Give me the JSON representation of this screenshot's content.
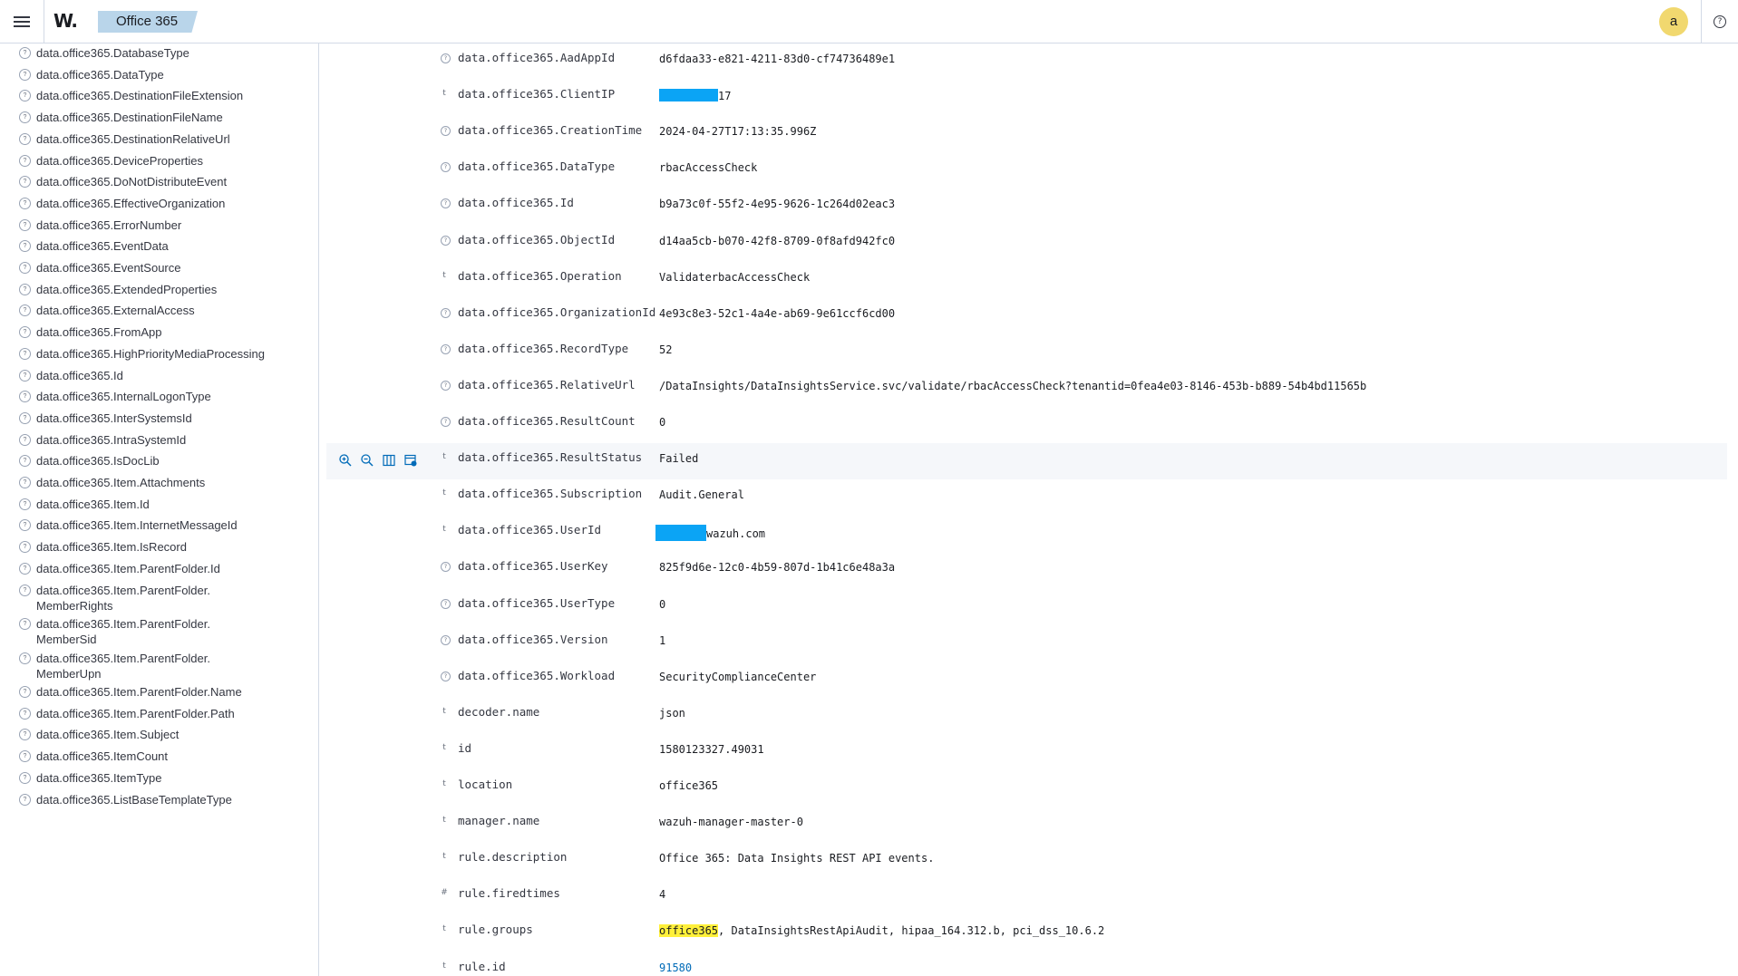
{
  "header": {
    "logo": "W.",
    "breadcrumb": "Office 365",
    "avatar_letter": "a",
    "help_glyph": "?",
    "colors": {
      "breadcrumb_bg": "#b9d5ea",
      "avatar_bg": "#f1d86f",
      "redaction": "#0ba4f5",
      "highlight": "#fff03a"
    }
  },
  "sidebar": {
    "icon": "field-type-unknown-icon",
    "items": [
      "data.office365.DatabaseType",
      "data.office365.DataType",
      "data.office365.DestinationFileExtension",
      "data.office365.DestinationFileName",
      "data.office365.DestinationRelativeUrl",
      "data.office365.DeviceProperties",
      "data.office365.DoNotDistributeEvent",
      "data.office365.EffectiveOrganization",
      "data.office365.ErrorNumber",
      "data.office365.EventData",
      "data.office365.EventSource",
      "data.office365.ExtendedProperties",
      "data.office365.ExternalAccess",
      "data.office365.FromApp",
      "data.office365.HighPriorityMediaProcessing",
      "data.office365.Id",
      "data.office365.InternalLogonType",
      "data.office365.InterSystemsId",
      "data.office365.IntraSystemId",
      "data.office365.IsDocLib",
      "data.office365.Item.Attachments",
      "data.office365.Item.Id",
      "data.office365.Item.InternetMessageId",
      "data.office365.Item.IsRecord",
      "data.office365.Item.ParentFolder.Id",
      "data.office365.Item.ParentFolder.\nMemberRights",
      "data.office365.Item.ParentFolder.\nMemberSid",
      "data.office365.Item.ParentFolder.\nMemberUpn",
      "data.office365.Item.ParentFolder.Name",
      "data.office365.Item.ParentFolder.Path",
      "data.office365.Item.Subject",
      "data.office365.ItemCount",
      "data.office365.ItemType",
      "data.office365.ListBaseTemplateType"
    ]
  },
  "doc": {
    "row_actions": [
      "zoom-in-icon",
      "zoom-out-icon",
      "toggle-column-icon",
      "filter-exists-icon"
    ],
    "rows": [
      {
        "type": "?",
        "key": "data.office365.AadAppId",
        "value": "d6fdaa33-e821-4211-83d0-cf74736489e1"
      },
      {
        "type": "t",
        "key": "data.office365.ClientIP",
        "value": "17",
        "redacted_prefix": true
      },
      {
        "type": "?",
        "key": "data.office365.CreationTime",
        "value": "2024-04-27T17:13:35.996Z"
      },
      {
        "type": "?",
        "key": "data.office365.DataType",
        "value": "rbacAccessCheck"
      },
      {
        "type": "?",
        "key": "data.office365.Id",
        "value": "b9a73c0f-55f2-4e95-9626-1c264d02eac3"
      },
      {
        "type": "?",
        "key": "data.office365.ObjectId",
        "value": "d14aa5cb-b070-42f8-8709-0f8afd942fc0"
      },
      {
        "type": "t",
        "key": "data.office365.Operation",
        "value": "ValidaterbacAccessCheck"
      },
      {
        "type": "?",
        "key": "data.office365.OrganizationId",
        "value": "4e93c8e3-52c1-4a4e-ab69-9e61ccf6cd00"
      },
      {
        "type": "?",
        "key": "data.office365.RecordType",
        "value": "52"
      },
      {
        "type": "?",
        "key": "data.office365.RelativeUrl",
        "value": "/DataInsights/DataInsightsService.svc/validate/rbacAccessCheck?tenantid=0fea4e03-8146-453b-b889-54b4bd11565b"
      },
      {
        "type": "?",
        "key": "data.office365.ResultCount",
        "value": "0"
      },
      {
        "type": "t",
        "key": "data.office365.ResultStatus",
        "value": "Failed",
        "hovered": true
      },
      {
        "type": "t",
        "key": "data.office365.Subscription",
        "value": "Audit.General"
      },
      {
        "type": "t",
        "key": "data.office365.UserId",
        "value": "wazuh.com",
        "redacted_prefix": true
      },
      {
        "type": "?",
        "key": "data.office365.UserKey",
        "value": "825f9d6e-12c0-4b59-807d-1b41c6e48a3a"
      },
      {
        "type": "?",
        "key": "data.office365.UserType",
        "value": "0"
      },
      {
        "type": "?",
        "key": "data.office365.Version",
        "value": "1"
      },
      {
        "type": "?",
        "key": "data.office365.Workload",
        "value": "SecurityComplianceCenter"
      },
      {
        "type": "t",
        "key": "decoder.name",
        "value": "json"
      },
      {
        "type": "t",
        "key": "id",
        "value": "1580123327.49031"
      },
      {
        "type": "t",
        "key": "location",
        "value": "office365"
      },
      {
        "type": "t",
        "key": "manager.name",
        "value": "wazuh-manager-master-0"
      },
      {
        "type": "t",
        "key": "rule.description",
        "value": "Office 365: Data Insights REST API events."
      },
      {
        "type": "#",
        "key": "rule.firedtimes",
        "value": "4"
      },
      {
        "type": "t",
        "key": "rule.groups",
        "value_highlight": "office365",
        "value": ", DataInsightsRestApiAudit, hipaa_164.312.b, pci_dss_10.6.2"
      },
      {
        "type": "t",
        "key": "rule.id",
        "value": "91580",
        "link": true
      }
    ]
  }
}
